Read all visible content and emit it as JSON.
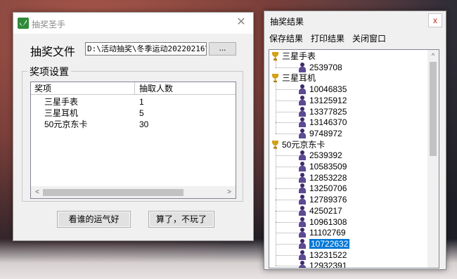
{
  "main_window": {
    "title": "抽奖圣手",
    "close_glyph": "✕",
    "file_label": "抽奖文件",
    "file_path": "D:\\活动抽奖\\冬季运动20220216\\",
    "browse_label": "...",
    "group_title": "奖项设置",
    "columns": [
      "奖项",
      "抽取人数"
    ],
    "prizes": [
      {
        "name": "三星手表",
        "count": "1"
      },
      {
        "name": "三星耳机",
        "count": "5"
      },
      {
        "name": "50元京东卡",
        "count": "30"
      }
    ],
    "scroll_left_glyph": "<",
    "scroll_right_glyph": ">",
    "lucky_button": "看谁的运气好",
    "quit_button": "算了，不玩了"
  },
  "results_window": {
    "title": "抽奖结果",
    "close_glyph": "x",
    "menu": [
      "保存结果",
      "打印结果",
      "关闭窗口"
    ],
    "scroll_up_glyph": "^",
    "groups": [
      {
        "prize": "三星手表",
        "winners": [
          "2539708"
        ]
      },
      {
        "prize": "三星耳机",
        "winners": [
          "10046835",
          "13125912",
          "13377825",
          "13146370",
          "9748972"
        ]
      },
      {
        "prize": "50元京东卡",
        "winners": [
          "2539392",
          "10583509",
          "12853228",
          "13250706",
          "12789376",
          "4250217",
          "10961308",
          "11102769",
          "10722632",
          "13231522",
          "12932391"
        ]
      }
    ],
    "selected_winner": "10722632"
  },
  "icons": {
    "app_icon": "app-icon",
    "trophy_icon": "trophy-icon",
    "person_icon": "person-icon"
  },
  "colors": {
    "selection": "#0078d7",
    "close_red": "#c42b1c",
    "trophy_gold": "#d4a017"
  }
}
